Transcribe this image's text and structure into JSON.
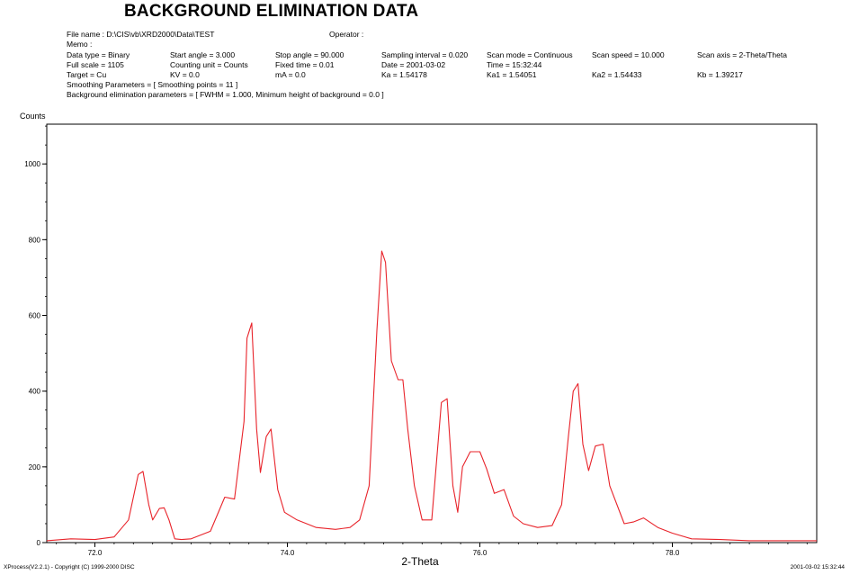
{
  "header": {
    "title": "BACKGROUND ELIMINATION DATA",
    "file_name": "File name : D:\\CIS\\vb\\XRD2000\\Data\\TEST",
    "operator": "Operator :",
    "memo": "Memo :",
    "row1": [
      "Data type = Binary",
      "Start angle = 3.000",
      "Stop angle = 90.000",
      "Sampling interval = 0.020",
      "Scan mode = Continuous",
      "Scan speed = 10.000",
      "Scan axis = 2-Theta/Theta"
    ],
    "row2": [
      "Full scale = 1105",
      "Counting unit = Counts",
      "Fixed time = 0.01",
      "Date = 2001-03-02",
      "Time = 15:32:44"
    ],
    "row3": [
      "Target = Cu",
      "KV  = 0.0",
      "mA  = 0.0",
      "Ka  = 1.54178",
      "Ka1  = 1.54051",
      "Ka2  = 1.54433",
      "Kb  = 1.39217"
    ],
    "smoothing": "Smoothing Parameters = [ Smoothing points = 11 ]",
    "background": "Background elimination parameters = [ FWHM = 1.000,  Minimum height of background = 0.0 ]"
  },
  "footer": {
    "left": "XProcess(V2.2.1) - Copyright (C) 1999-2000 DISC",
    "right": "2001-03-02  15:32:44"
  },
  "colors": {
    "line": "#e8232a",
    "axis": "#000000"
  },
  "chart_data": {
    "type": "line",
    "xlabel": "2-Theta",
    "ylabel": "Counts",
    "xlim": [
      71.5,
      79.5
    ],
    "ylim": [
      0,
      1105
    ],
    "xticks": [
      72.0,
      74.0,
      76.0,
      78.0
    ],
    "xtick_labels": [
      "72.0",
      "74.0",
      "76.0",
      "78.0"
    ],
    "yticks": [
      0,
      200,
      400,
      600,
      800,
      1000
    ],
    "ytick_labels": [
      "0",
      "200",
      "400",
      "600",
      "800",
      "1000"
    ],
    "x": [
      71.5,
      71.75,
      72.0,
      72.2,
      72.35,
      72.45,
      72.5,
      72.56,
      72.6,
      72.67,
      72.72,
      72.77,
      72.83,
      72.9,
      73.0,
      73.2,
      73.35,
      73.45,
      73.55,
      73.58,
      73.63,
      73.68,
      73.72,
      73.78,
      73.83,
      73.9,
      73.97,
      74.1,
      74.3,
      74.5,
      74.65,
      74.75,
      74.85,
      74.93,
      74.98,
      75.02,
      75.08,
      75.15,
      75.2,
      75.25,
      75.32,
      75.4,
      75.5,
      75.6,
      75.66,
      75.72,
      75.77,
      75.82,
      75.9,
      76.0,
      76.07,
      76.15,
      76.25,
      76.35,
      76.45,
      76.6,
      76.75,
      76.85,
      76.92,
      76.97,
      77.02,
      77.07,
      77.13,
      77.2,
      77.28,
      77.35,
      77.5,
      77.6,
      77.7,
      77.85,
      78.0,
      78.2,
      78.5,
      78.8,
      79.2,
      79.5
    ],
    "y": [
      5,
      10,
      8,
      15,
      60,
      180,
      188,
      100,
      60,
      90,
      92,
      60,
      10,
      8,
      10,
      30,
      120,
      115,
      320,
      540,
      580,
      300,
      185,
      280,
      300,
      140,
      80,
      60,
      40,
      35,
      40,
      60,
      150,
      560,
      770,
      740,
      480,
      430,
      430,
      300,
      150,
      60,
      60,
      370,
      380,
      150,
      80,
      200,
      240,
      240,
      195,
      130,
      140,
      70,
      50,
      40,
      45,
      100,
      280,
      400,
      420,
      260,
      190,
      255,
      260,
      150,
      50,
      55,
      65,
      40,
      25,
      10,
      8,
      5,
      5,
      5
    ]
  }
}
